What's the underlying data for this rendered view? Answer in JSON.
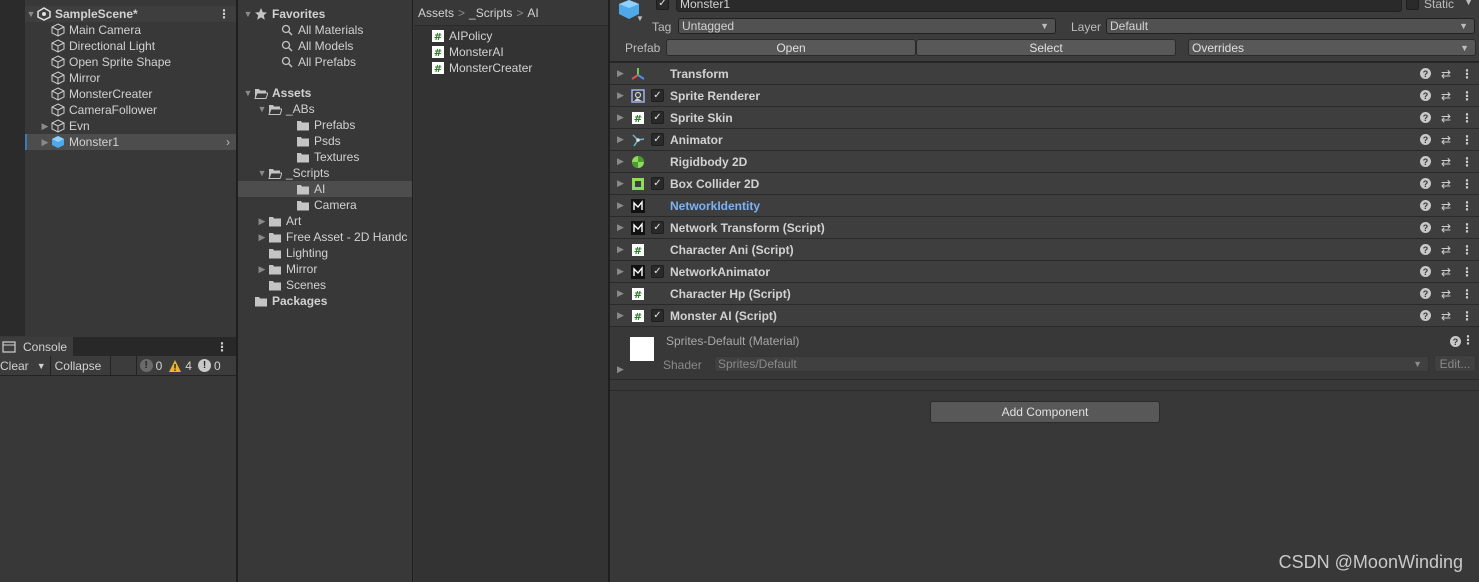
{
  "hierarchy": {
    "scene": "SampleScene*",
    "items": [
      "Main Camera",
      "Directional Light",
      "Open Sprite Shape",
      "Mirror",
      "MonsterCreater",
      "CameraFollower",
      "Evn",
      "Monster1"
    ]
  },
  "console": {
    "tab": "Console",
    "clear": "Clear",
    "collapse": "Collapse",
    "counts": {
      "info": "0",
      "warn": "4",
      "error": "0"
    }
  },
  "project": {
    "favorites": "Favorites",
    "fav_items": [
      "All Materials",
      "All Models",
      "All Prefabs"
    ],
    "assets": "Assets",
    "abs": "_ABs",
    "abs_children": [
      "Prefabs",
      "Psds",
      "Textures"
    ],
    "scripts": "_Scripts",
    "scripts_children": [
      "AI",
      "Camera"
    ],
    "other": [
      "Art",
      "Free Asset - 2D Handc",
      "Lighting",
      "Mirror",
      "Scenes"
    ],
    "packages": "Packages",
    "breadcrumb": [
      "Assets",
      "_Scripts",
      "AI"
    ],
    "files": [
      "AIPolicy",
      "MonsterAI",
      "MonsterCreater"
    ]
  },
  "inspector": {
    "name": "Monster1",
    "static": "Static",
    "tag_label": "Tag",
    "tag": "Untagged",
    "layer_label": "Layer",
    "layer": "Default",
    "prefab_label": "Prefab",
    "open": "Open",
    "select": "Select",
    "overrides": "Overrides",
    "components": [
      {
        "name": "Transform",
        "check": false,
        "icon": "transform-icon"
      },
      {
        "name": "Sprite Renderer",
        "check": true,
        "icon": "sprite-renderer-icon"
      },
      {
        "name": "Sprite Skin",
        "check": true,
        "icon": "script-icon"
      },
      {
        "name": "Animator",
        "check": true,
        "icon": "animator-icon"
      },
      {
        "name": "Rigidbody 2D",
        "check": false,
        "icon": "rigidbody-icon"
      },
      {
        "name": "Box Collider 2D",
        "check": true,
        "icon": "box-collider-icon"
      },
      {
        "name": "NetworkIdentity",
        "check": false,
        "icon": "network-icon",
        "color": "#7bb3f5"
      },
      {
        "name": "Network Transform (Script)",
        "check": true,
        "icon": "network-icon"
      },
      {
        "name": "Character Ani (Script)",
        "check": false,
        "icon": "script-icon"
      },
      {
        "name": "NetworkAnimator",
        "check": true,
        "icon": "network-icon"
      },
      {
        "name": "Character Hp (Script)",
        "check": false,
        "icon": "script-icon"
      },
      {
        "name": "Monster AI (Script)",
        "check": true,
        "icon": "script-icon"
      }
    ],
    "material": "Sprites-Default (Material)",
    "shader_label": "Shader",
    "shader": "Sprites/Default",
    "edit": "Edit...",
    "add_component": "Add Component"
  },
  "watermark": "CSDN @MoonWinding"
}
